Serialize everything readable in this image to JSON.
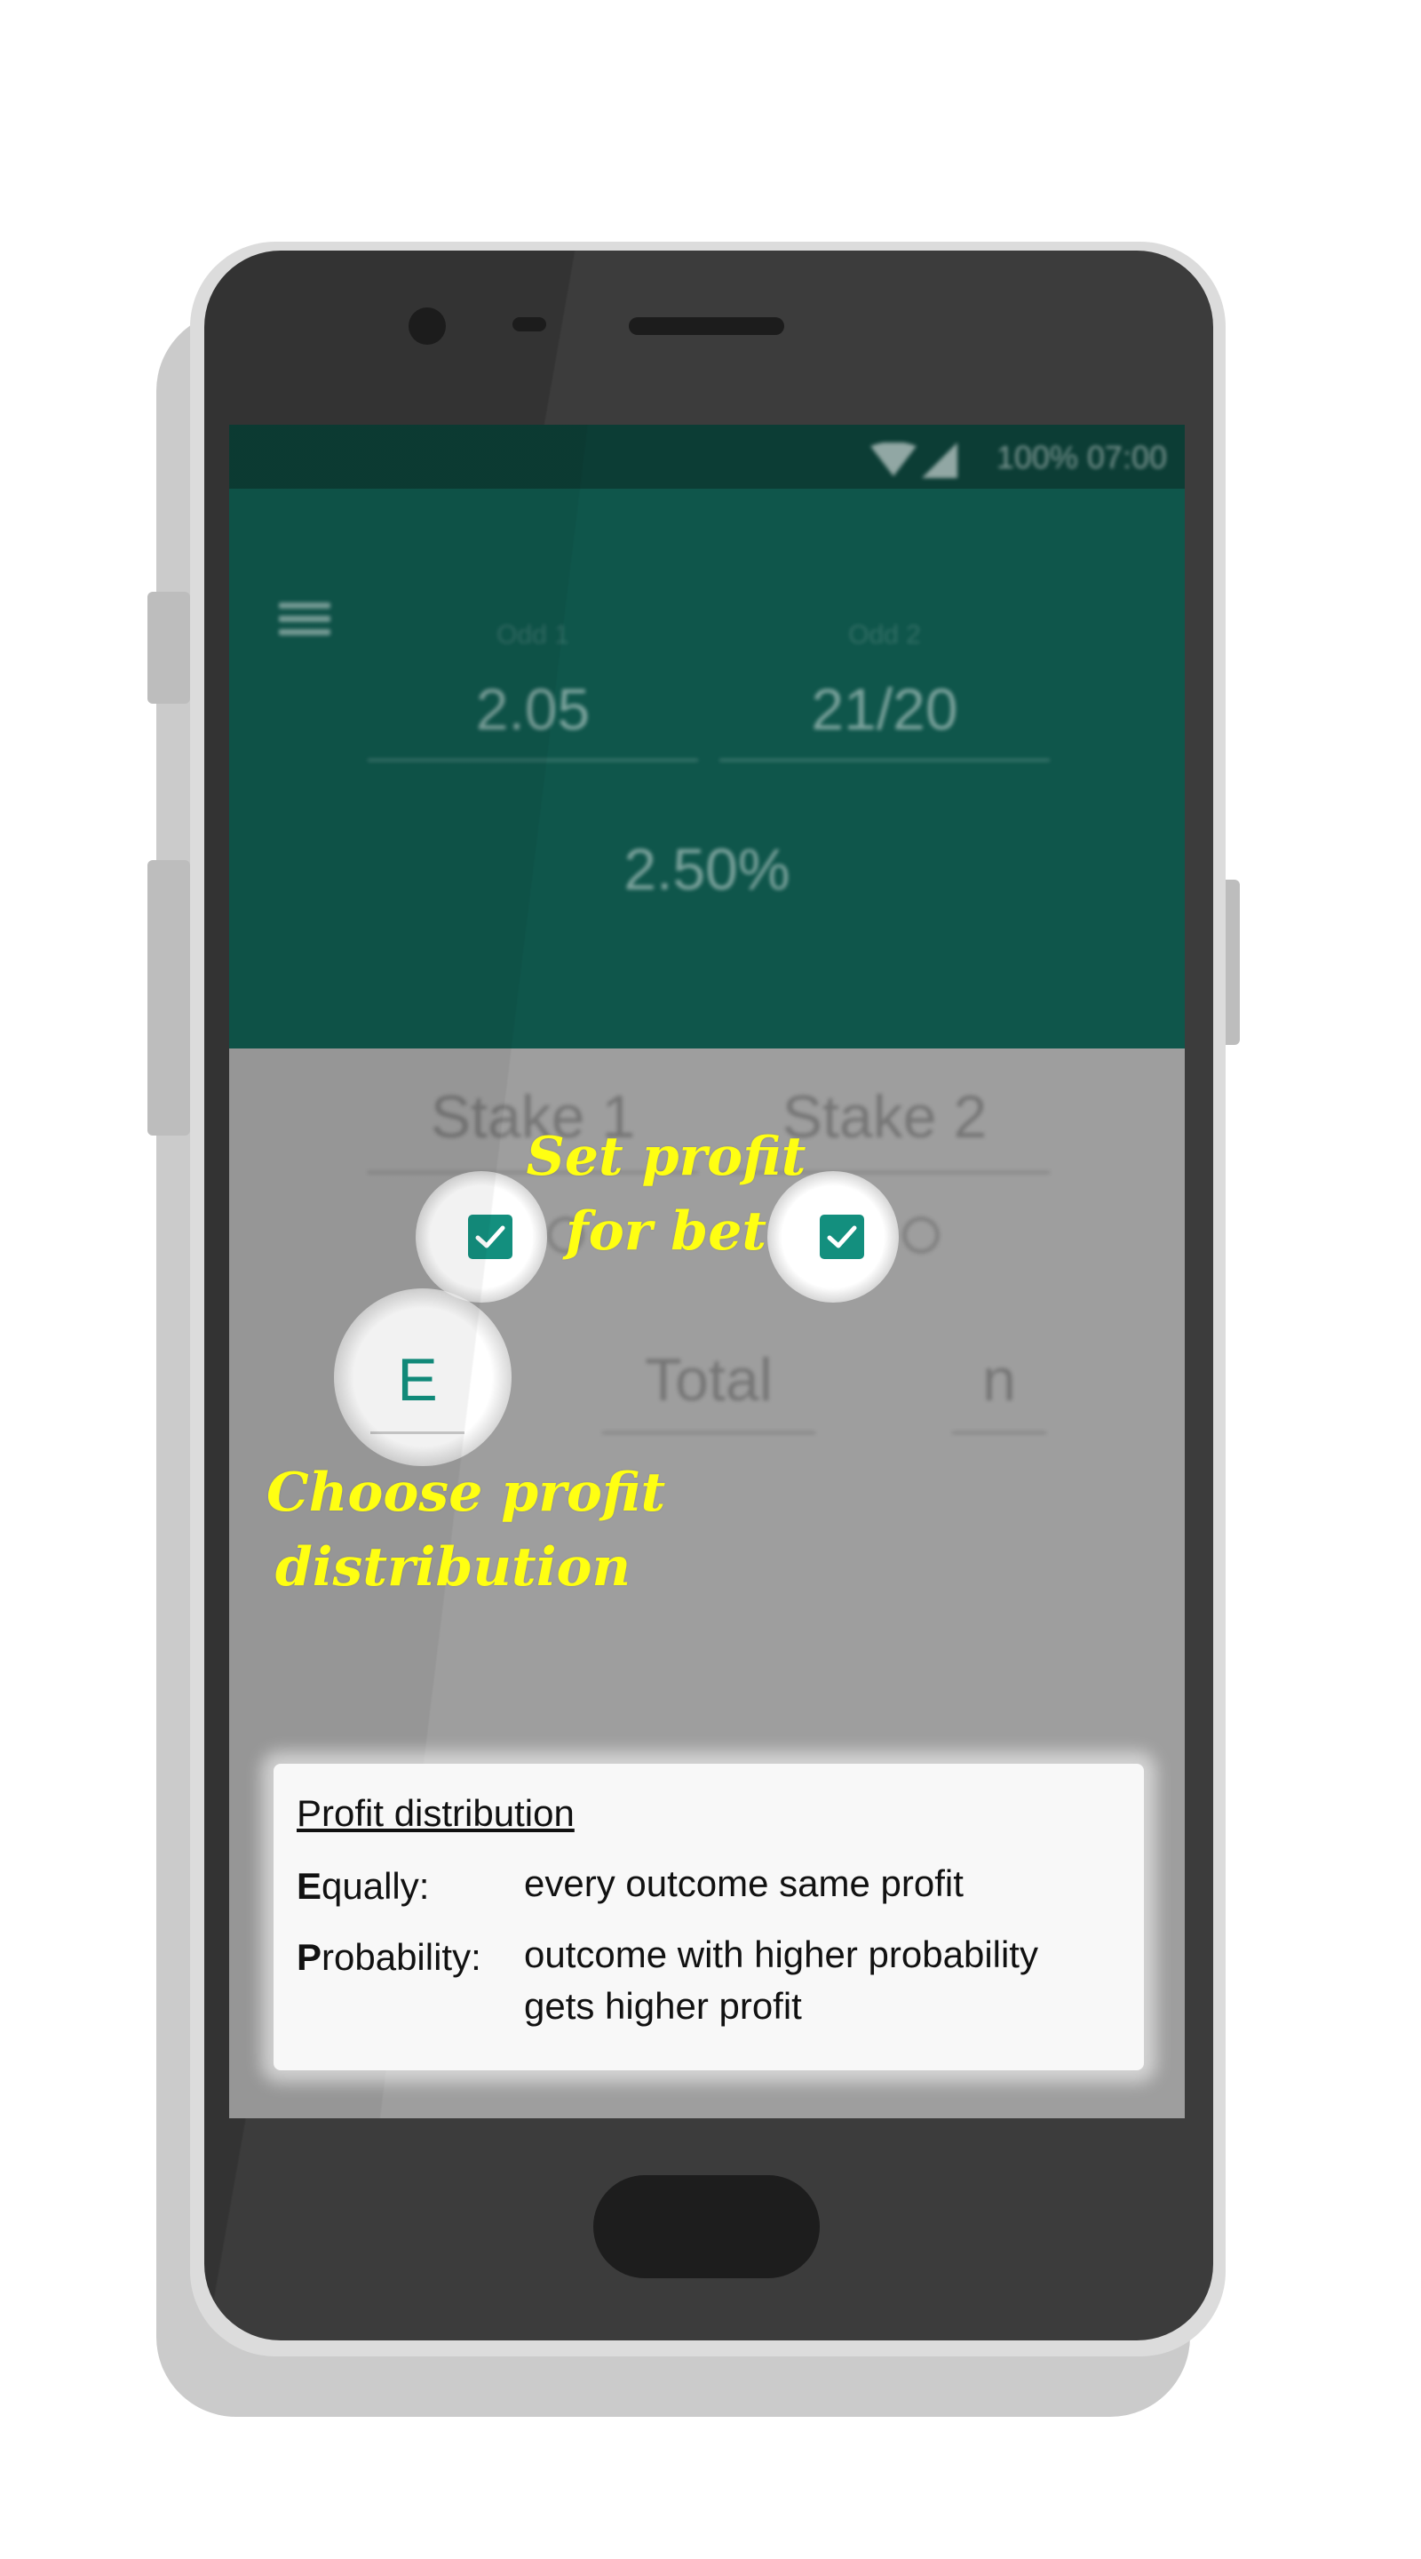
{
  "status_bar": {
    "battery_time": "100% 07:00"
  },
  "icons": {
    "wifi": "wifi-icon",
    "signal": "signal-icon",
    "menu": "hamburger-menu-icon",
    "check": "checkmark-icon"
  },
  "colors": {
    "app_bar": "#0f564b",
    "status_bar": "#0c3d35",
    "accent": "#138f7e",
    "annotation": "#ffff12",
    "overlay": "#9e9e9e"
  },
  "odds": {
    "odd1_label": "Odd 1",
    "odd1_value": "2.05",
    "odd2_label": "Odd 2",
    "odd2_value": "21/20"
  },
  "margin_value": "2.50%",
  "stakes": {
    "stake1_placeholder": "Stake 1",
    "stake2_placeholder": "Stake 2",
    "stake1_profit_checked": true,
    "stake2_profit_checked": true
  },
  "distribution": {
    "selected": "E",
    "total_placeholder": "Total",
    "n_placeholder": "n"
  },
  "annotations": {
    "set_profit_line1": "Set profit",
    "set_profit_line2": "for bet",
    "choose_line1": "Choose profit",
    "choose_line2": "distribution"
  },
  "info": {
    "title": "Profit distribution",
    "equally_initial": "E",
    "equally_rest": "qually:",
    "equally_desc": "every outcome same profit",
    "probability_initial": "P",
    "probability_rest": "robability:",
    "probability_desc_line1": "outcome with higher probability",
    "probability_desc_line2": "gets higher profit"
  }
}
